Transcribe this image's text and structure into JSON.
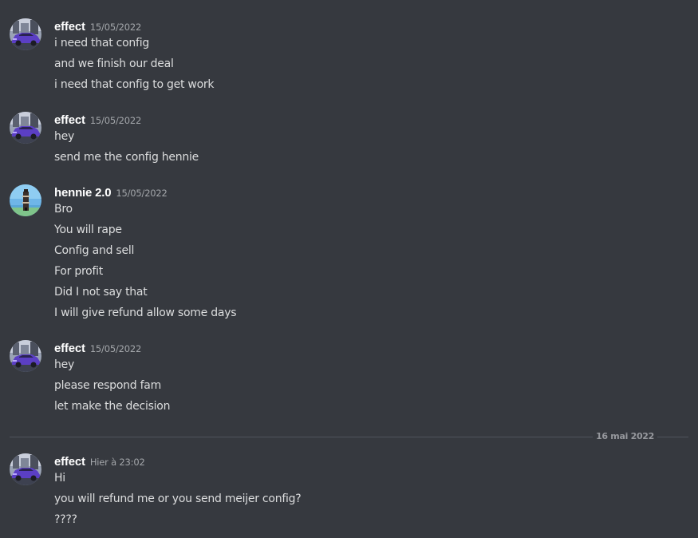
{
  "messages": {
    "groups": [
      {
        "username": "effect",
        "timestamp": "15/05/2022",
        "avatar": "purple-car-avatar",
        "lines": [
          "i need that config",
          "and we finish our deal",
          "i need that config to get work"
        ]
      },
      {
        "username": "effect",
        "timestamp": "15/05/2022",
        "avatar": "purple-car-avatar",
        "lines": [
          "hey",
          "send me the config hennie"
        ]
      },
      {
        "username": "hennie 2.0",
        "timestamp": "15/05/2022",
        "avatar": "lighthouse-avatar",
        "lines": [
          "Bro",
          "You will rape",
          "Config and sell",
          "For profit",
          "Did I not say that",
          "I will give refund allow some days"
        ]
      },
      {
        "username": "effect",
        "timestamp": "15/05/2022",
        "avatar": "purple-car-avatar",
        "lines": [
          "hey",
          "please respond fam",
          "let make the decision"
        ]
      },
      {
        "username": "effect",
        "timestamp": "Hier à 23:02",
        "avatar": "purple-car-avatar",
        "lines": [
          "Hi",
          "you will refund me or you send meijer config?",
          "????"
        ]
      }
    ],
    "date_divider": "16 mai 2022"
  },
  "colors": {
    "background": "#36393f",
    "username": "#ffffff",
    "message_text": "#dcddde",
    "timestamp": "#a3a6aa",
    "divider": "#4f545c"
  }
}
